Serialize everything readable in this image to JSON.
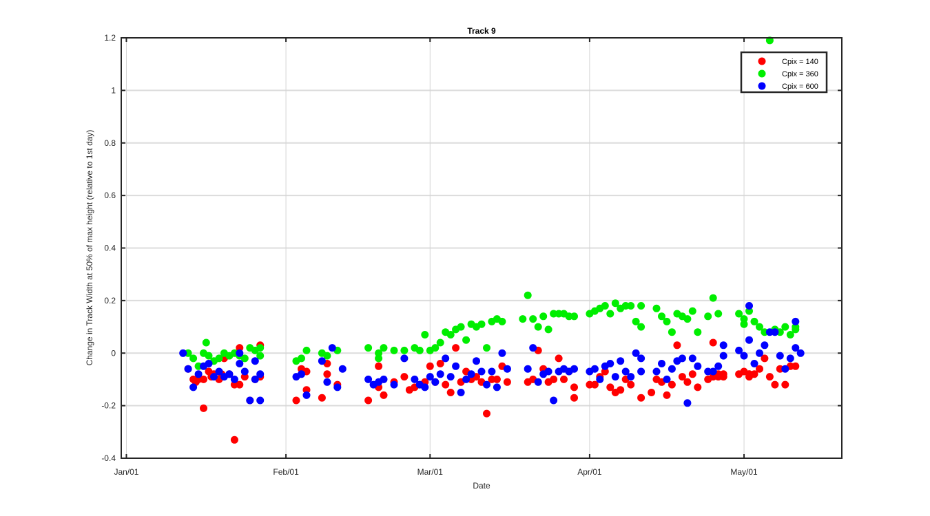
{
  "chart_data": {
    "type": "scatter",
    "title": "Track 9",
    "xlabel": "Date",
    "ylabel": "Change in Track Width at 50% of max height (relative to 1st day)",
    "x_ticks": [
      "Jan/01",
      "Feb/01",
      "Mar/01",
      "Apr/01",
      "May/01"
    ],
    "x_tick_days": [
      0,
      31,
      59,
      90,
      120
    ],
    "xlim_days": [
      -1,
      139
    ],
    "y_ticks": [
      "-0.4",
      "-0.2",
      "0",
      "0.2",
      "0.4",
      "0.6",
      "0.8",
      "1",
      "1.2"
    ],
    "ylim": [
      -0.4,
      1.2
    ],
    "grid": true,
    "legend_position": "top-right",
    "series": [
      {
        "name": "Cpix = 140",
        "color": "#ff0000",
        "points": [
          [
            12,
            -0.06
          ],
          [
            13,
            -0.1
          ],
          [
            13.5,
            -0.11
          ],
          [
            14,
            -0.1
          ],
          [
            15,
            -0.21
          ],
          [
            15,
            -0.1
          ],
          [
            16,
            -0.07
          ],
          [
            16.5,
            -0.09
          ],
          [
            17,
            -0.08
          ],
          [
            18,
            -0.1
          ],
          [
            18.5,
            -0.08
          ],
          [
            19,
            -0.02
          ],
          [
            20,
            -0.08
          ],
          [
            21,
            -0.33
          ],
          [
            21,
            -0.12
          ],
          [
            22,
            0.02
          ],
          [
            22,
            -0.12
          ],
          [
            23,
            -0.09
          ],
          [
            24,
            -0.18
          ],
          [
            25,
            -0.1
          ],
          [
            26,
            0.03
          ],
          [
            26,
            -0.09
          ],
          [
            33,
            -0.18
          ],
          [
            34,
            -0.06
          ],
          [
            35,
            -0.14
          ],
          [
            35,
            -0.07
          ],
          [
            38,
            -0.17
          ],
          [
            39,
            -0.04
          ],
          [
            39,
            -0.08
          ],
          [
            41,
            -0.12
          ],
          [
            47,
            -0.18
          ],
          [
            49,
            -0.05
          ],
          [
            49,
            -0.13
          ],
          [
            50,
            -0.16
          ],
          [
            52,
            -0.11
          ],
          [
            54,
            -0.09
          ],
          [
            55,
            -0.14
          ],
          [
            56,
            -0.13
          ],
          [
            57,
            -0.12
          ],
          [
            58,
            -0.11
          ],
          [
            59,
            -0.05
          ],
          [
            60,
            -0.11
          ],
          [
            61,
            -0.04
          ],
          [
            62,
            -0.12
          ],
          [
            63,
            -0.15
          ],
          [
            64,
            0.02
          ],
          [
            65,
            -0.11
          ],
          [
            66,
            -0.07
          ],
          [
            67,
            -0.1
          ],
          [
            68,
            -0.09
          ],
          [
            69,
            -0.11
          ],
          [
            70,
            -0.23
          ],
          [
            71,
            -0.1
          ],
          [
            72,
            -0.1
          ],
          [
            73,
            -0.05
          ],
          [
            74,
            -0.11
          ],
          [
            78,
            -0.11
          ],
          [
            79,
            -0.1
          ],
          [
            80,
            0.01
          ],
          [
            81,
            -0.06
          ],
          [
            82,
            -0.11
          ],
          [
            83,
            -0.1
          ],
          [
            84,
            -0.02
          ],
          [
            85,
            -0.1
          ],
          [
            86,
            -0.07
          ],
          [
            87,
            -0.17
          ],
          [
            87,
            -0.13
          ],
          [
            90,
            -0.12
          ],
          [
            91,
            -0.12
          ],
          [
            92,
            -0.09
          ],
          [
            93,
            -0.07
          ],
          [
            94,
            -0.13
          ],
          [
            95,
            -0.15
          ],
          [
            96,
            -0.14
          ],
          [
            97,
            -0.1
          ],
          [
            98,
            -0.12
          ],
          [
            100,
            -0.17
          ],
          [
            102,
            -0.15
          ],
          [
            103,
            -0.1
          ],
          [
            104,
            -0.11
          ],
          [
            105,
            -0.16
          ],
          [
            106,
            -0.12
          ],
          [
            107,
            0.03
          ],
          [
            108,
            -0.09
          ],
          [
            109,
            -0.11
          ],
          [
            110,
            -0.08
          ],
          [
            111,
            -0.13
          ],
          [
            113,
            -0.1
          ],
          [
            114,
            0.04
          ],
          [
            115,
            -0.09
          ],
          [
            119,
            -0.08
          ],
          [
            120,
            -0.07
          ],
          [
            121,
            -0.09
          ],
          [
            121,
            -0.08
          ],
          [
            114,
            -0.09
          ],
          [
            115,
            -0.08
          ],
          [
            116,
            -0.08
          ],
          [
            116,
            -0.09
          ],
          [
            121,
            -0.08
          ],
          [
            122,
            -0.08
          ],
          [
            123,
            -0.06
          ],
          [
            124,
            -0.02
          ],
          [
            125,
            -0.09
          ],
          [
            126,
            -0.12
          ],
          [
            127,
            -0.06
          ],
          [
            128,
            -0.12
          ],
          [
            129,
            -0.05
          ],
          [
            130,
            -0.05
          ]
        ]
      },
      {
        "name": "Cpix = 360",
        "color": "#00ee00",
        "points": [
          [
            12,
            0.0
          ],
          [
            13,
            -0.02
          ],
          [
            14,
            -0.05
          ],
          [
            15,
            0.0
          ],
          [
            15.5,
            0.04
          ],
          [
            16,
            -0.01
          ],
          [
            17,
            -0.03
          ],
          [
            18,
            -0.02
          ],
          [
            19,
            0.0
          ],
          [
            20,
            -0.01
          ],
          [
            21,
            0.0
          ],
          [
            22,
            -0.01
          ],
          [
            23,
            -0.02
          ],
          [
            24,
            0.02
          ],
          [
            25,
            0.01
          ],
          [
            26,
            -0.01
          ],
          [
            26,
            0.02
          ],
          [
            33,
            -0.03
          ],
          [
            34,
            -0.02
          ],
          [
            35,
            0.01
          ],
          [
            38,
            0.0
          ],
          [
            39,
            -0.01
          ],
          [
            41,
            0.01
          ],
          [
            47,
            0.02
          ],
          [
            49,
            0.0
          ],
          [
            49,
            -0.02
          ],
          [
            50,
            0.02
          ],
          [
            52,
            0.01
          ],
          [
            54,
            0.01
          ],
          [
            56,
            0.02
          ],
          [
            57,
            0.01
          ],
          [
            58,
            0.07
          ],
          [
            59,
            0.01
          ],
          [
            60,
            0.02
          ],
          [
            61,
            0.04
          ],
          [
            62,
            0.08
          ],
          [
            63,
            0.07
          ],
          [
            64,
            0.09
          ],
          [
            65,
            0.1
          ],
          [
            66,
            0.05
          ],
          [
            67,
            0.11
          ],
          [
            68,
            0.1
          ],
          [
            69,
            0.11
          ],
          [
            70,
            0.02
          ],
          [
            71,
            0.12
          ],
          [
            72,
            0.13
          ],
          [
            73,
            0.12
          ],
          [
            77,
            0.13
          ],
          [
            78,
            0.22
          ],
          [
            79,
            0.13
          ],
          [
            80,
            0.1
          ],
          [
            81,
            0.14
          ],
          [
            82,
            0.09
          ],
          [
            83,
            0.15
          ],
          [
            84,
            0.15
          ],
          [
            85,
            0.15
          ],
          [
            86,
            0.14
          ],
          [
            87,
            0.14
          ],
          [
            90,
            0.15
          ],
          [
            91,
            0.16
          ],
          [
            92,
            0.17
          ],
          [
            93,
            0.18
          ],
          [
            94,
            0.15
          ],
          [
            95,
            0.19
          ],
          [
            96,
            0.17
          ],
          [
            97,
            0.18
          ],
          [
            98,
            0.18
          ],
          [
            99,
            0.12
          ],
          [
            100,
            0.18
          ],
          [
            100,
            0.1
          ],
          [
            103,
            0.17
          ],
          [
            104,
            0.14
          ],
          [
            105,
            0.12
          ],
          [
            106,
            0.08
          ],
          [
            107,
            0.15
          ],
          [
            108,
            0.14
          ],
          [
            109,
            0.13
          ],
          [
            110,
            0.16
          ],
          [
            111,
            0.08
          ],
          [
            113,
            0.14
          ],
          [
            114,
            0.21
          ],
          [
            115,
            0.15
          ],
          [
            119,
            0.15
          ],
          [
            120,
            0.13
          ],
          [
            120,
            0.11
          ],
          [
            121,
            0.16
          ],
          [
            122,
            0.12
          ],
          [
            123,
            0.1
          ],
          [
            124,
            0.08
          ],
          [
            125,
            1.19
          ],
          [
            126,
            0.09
          ],
          [
            127,
            0.08
          ],
          [
            128,
            0.1
          ],
          [
            129,
            0.07
          ],
          [
            130,
            0.09
          ],
          [
            130,
            0.1
          ]
        ]
      },
      {
        "name": "Cpix = 600",
        "color": "#0000ff",
        "points": [
          [
            11,
            0.0
          ],
          [
            12,
            -0.06
          ],
          [
            13,
            -0.13
          ],
          [
            14,
            -0.08
          ],
          [
            15,
            -0.05
          ],
          [
            16,
            -0.04
          ],
          [
            17,
            -0.09
          ],
          [
            18,
            -0.07
          ],
          [
            19,
            -0.09
          ],
          [
            20,
            -0.08
          ],
          [
            21,
            -0.1
          ],
          [
            22,
            -0.04
          ],
          [
            22,
            0.0
          ],
          [
            23,
            -0.07
          ],
          [
            24,
            -0.18
          ],
          [
            25,
            -0.1
          ],
          [
            25,
            -0.03
          ],
          [
            26,
            -0.18
          ],
          [
            26,
            -0.08
          ],
          [
            33,
            -0.09
          ],
          [
            34,
            -0.08
          ],
          [
            35,
            -0.16
          ],
          [
            38,
            -0.03
          ],
          [
            39,
            -0.11
          ],
          [
            40,
            0.02
          ],
          [
            41,
            -0.13
          ],
          [
            42,
            -0.06
          ],
          [
            47,
            -0.1
          ],
          [
            48,
            -0.12
          ],
          [
            49,
            -0.11
          ],
          [
            50,
            -0.1
          ],
          [
            52,
            -0.12
          ],
          [
            54,
            -0.02
          ],
          [
            56,
            -0.1
          ],
          [
            57,
            -0.12
          ],
          [
            58,
            -0.13
          ],
          [
            59,
            -0.09
          ],
          [
            60,
            -0.11
          ],
          [
            61,
            -0.08
          ],
          [
            62,
            -0.02
          ],
          [
            63,
            -0.09
          ],
          [
            64,
            -0.05
          ],
          [
            65,
            -0.15
          ],
          [
            66,
            -0.1
          ],
          [
            67,
            -0.08
          ],
          [
            68,
            -0.03
          ],
          [
            69,
            -0.07
          ],
          [
            70,
            -0.12
          ],
          [
            71,
            -0.07
          ],
          [
            72,
            -0.13
          ],
          [
            73,
            0.0
          ],
          [
            74,
            -0.06
          ],
          [
            78,
            -0.06
          ],
          [
            79,
            0.02
          ],
          [
            80,
            -0.11
          ],
          [
            81,
            -0.08
          ],
          [
            82,
            -0.07
          ],
          [
            83,
            -0.18
          ],
          [
            84,
            -0.07
          ],
          [
            85,
            -0.06
          ],
          [
            86,
            -0.07
          ],
          [
            87,
            -0.06
          ],
          [
            90,
            -0.07
          ],
          [
            91,
            -0.06
          ],
          [
            92,
            -0.1
          ],
          [
            93,
            -0.05
          ],
          [
            94,
            -0.04
          ],
          [
            95,
            -0.09
          ],
          [
            96,
            -0.03
          ],
          [
            97,
            -0.07
          ],
          [
            98,
            -0.09
          ],
          [
            99,
            0.0
          ],
          [
            100,
            -0.07
          ],
          [
            100,
            -0.02
          ],
          [
            103,
            -0.07
          ],
          [
            104,
            -0.04
          ],
          [
            105,
            -0.1
          ],
          [
            106,
            -0.06
          ],
          [
            107,
            -0.03
          ],
          [
            108,
            -0.02
          ],
          [
            109,
            -0.19
          ],
          [
            110,
            -0.02
          ],
          [
            111,
            -0.05
          ],
          [
            113,
            -0.07
          ],
          [
            114,
            -0.07
          ],
          [
            115,
            -0.05
          ],
          [
            116,
            0.03
          ],
          [
            116,
            -0.01
          ],
          [
            119,
            0.01
          ],
          [
            120,
            -0.01
          ],
          [
            121,
            0.05
          ],
          [
            121,
            0.18
          ],
          [
            122,
            -0.04
          ],
          [
            123,
            0.0
          ],
          [
            124,
            0.03
          ],
          [
            125,
            0.08
          ],
          [
            126,
            0.08
          ],
          [
            127,
            -0.01
          ],
          [
            128,
            -0.06
          ],
          [
            129,
            -0.02
          ],
          [
            130,
            0.12
          ],
          [
            130,
            0.02
          ],
          [
            131,
            0.0
          ]
        ]
      }
    ]
  }
}
